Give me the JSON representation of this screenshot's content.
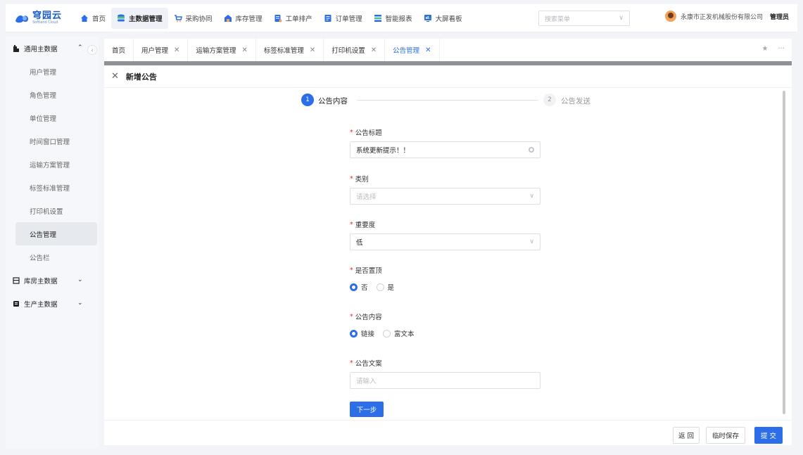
{
  "header": {
    "logo_text": "穹园云",
    "logo_sub": "Softland Cloud",
    "nav": [
      {
        "label": "首页",
        "icon": "home-icon",
        "active": false
      },
      {
        "label": "主数据管理",
        "icon": "database-icon",
        "active": true
      },
      {
        "label": "采购协同",
        "icon": "cart-icon",
        "active": false
      },
      {
        "label": "库存管理",
        "icon": "warehouse-icon",
        "active": false
      },
      {
        "label": "工单排产",
        "icon": "workorder-icon",
        "active": false
      },
      {
        "label": "订单管理",
        "icon": "order-icon",
        "active": false
      },
      {
        "label": "智能报表",
        "icon": "report-icon",
        "active": false
      },
      {
        "label": "大屏看板",
        "icon": "dashboard-icon",
        "active": false
      }
    ],
    "search_placeholder": "搜索菜单",
    "company": "永康市正发机械股份有限公司",
    "role": "管理员"
  },
  "sidebar": {
    "groups": [
      {
        "label": "通用主数据",
        "expanded": true,
        "items": [
          "用户管理",
          "角色管理",
          "单位管理",
          "时间窗口管理",
          "运输方案管理",
          "标签标准管理",
          "打印机设置",
          "公告管理",
          "公告栏"
        ],
        "active_index": 7
      },
      {
        "label": "库房主数据",
        "expanded": false
      },
      {
        "label": "生产主数据",
        "expanded": false
      }
    ]
  },
  "tabs": [
    {
      "label": "首页",
      "closable": false
    },
    {
      "label": "用户管理",
      "closable": true
    },
    {
      "label": "运输方案管理",
      "closable": true
    },
    {
      "label": "标签标准管理",
      "closable": true
    },
    {
      "label": "打印机设置",
      "closable": true
    },
    {
      "label": "公告管理",
      "closable": true,
      "active": true
    }
  ],
  "tab_tools": {
    "more": "···"
  },
  "panel": {
    "title": "新增公告",
    "steps": [
      {
        "num": "1",
        "label": "公告内容",
        "active": true
      },
      {
        "num": "2",
        "label": "公告发送",
        "active": false
      }
    ],
    "fields": {
      "title": {
        "label": "公告标题",
        "value": "系统更新提示！！"
      },
      "category": {
        "label": "类别",
        "placeholder": "请选择"
      },
      "importance": {
        "label": "重要度",
        "value": "低"
      },
      "pinned": {
        "label": "是否置顶",
        "options": [
          "否",
          "是"
        ],
        "selected": "否"
      },
      "content": {
        "label": "公告内容",
        "options": [
          "链接",
          "富文本"
        ],
        "selected": "链接"
      },
      "copy": {
        "label": "公告文案",
        "placeholder": "请输入"
      }
    },
    "next_label": "下一步",
    "footer": {
      "back": "返 回",
      "draft": "临时保存",
      "submit": "提 交"
    }
  },
  "colors": {
    "primary": "#2b6ee8",
    "required": "#f5222d"
  }
}
